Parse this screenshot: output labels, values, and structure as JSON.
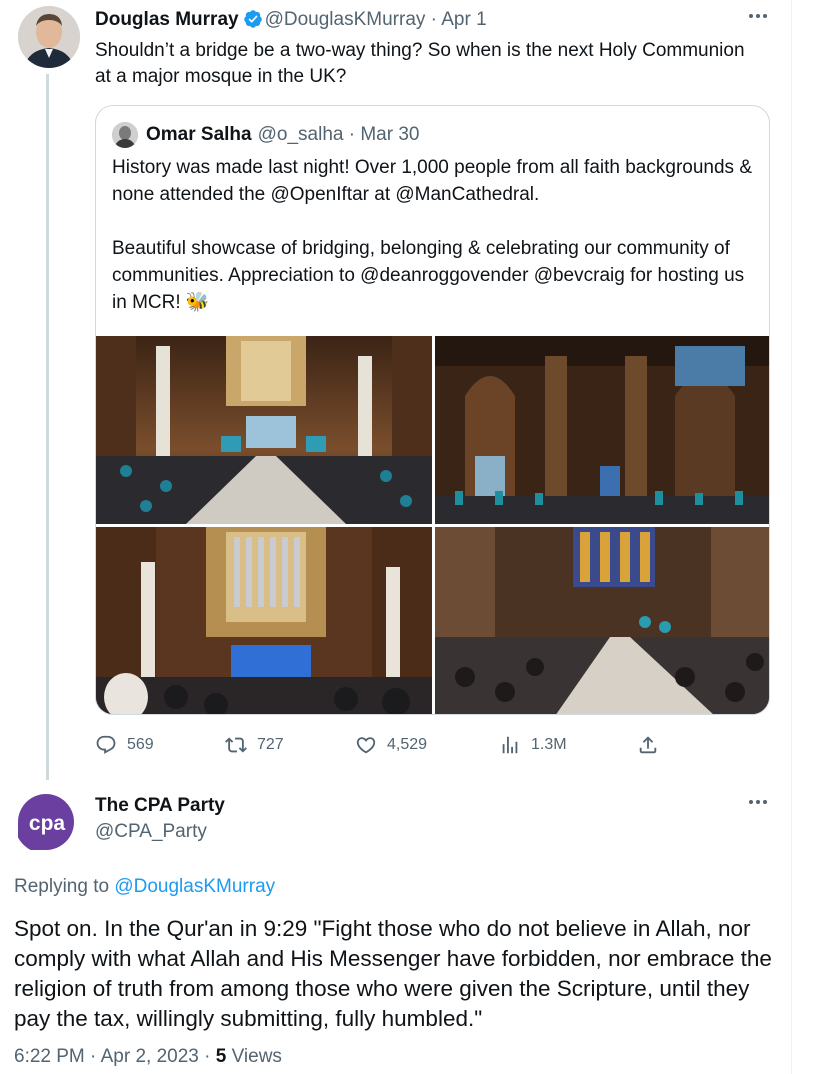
{
  "main_tweet": {
    "author_name": "Douglas Murray",
    "handle": "@DouglasKMurray",
    "date": "· Apr 1",
    "text": "Shouldn’t a bridge be a two-way thing? So when is the next Holy Communion at a major mosque in the UK?",
    "quoted": {
      "author_name": "Omar Salha",
      "handle": "@o_salha",
      "date": "· Mar 30",
      "paragraphs": [
        "History was made last night! Over 1,000 people from all faith backgrounds & none attended the @OpenIftar at @ManCathedral.",
        "Beautiful showcase of bridging, belonging & celebrating our community of communities. Appreciation to @deanroggovender @bevcraig for hosting us in MCR! 🐝"
      ],
      "photos": [
        "cathedral-iftar-photo-1",
        "cathedral-iftar-photo-2",
        "cathedral-iftar-photo-3",
        "cathedral-iftar-photo-4"
      ]
    },
    "metrics": {
      "replies": "569",
      "retweets": "727",
      "likes": "4,529",
      "views": "1.3M"
    }
  },
  "reply_tweet": {
    "author_name": "The CPA Party",
    "handle": "@CPA_Party",
    "avatar_text": "cpa",
    "replying_prefix": "Replying to",
    "replying_to": "@DouglasKMurray",
    "text": "Spot on. In the Qur'an in 9:29 \"Fight those who do not believe in Allah, nor comply with what Allah and His Messenger have forbidden, nor embrace the religion of truth from among those who were given the Scripture, until they pay the tax, willingly submitting, fully humbled.\"",
    "time": "6:22 PM",
    "date": "· Apr 2, 2023 ·",
    "views_count": "5",
    "views_label": "Views"
  },
  "colors": {
    "accent": "#1d9bf0",
    "muted": "#536471",
    "border": "#cfd9de",
    "cpa_purple": "#6b3fa0"
  },
  "icons": [
    "verified-badge-icon",
    "more-icon",
    "reply-icon",
    "retweet-icon",
    "like-icon",
    "views-icon",
    "share-icon"
  ]
}
